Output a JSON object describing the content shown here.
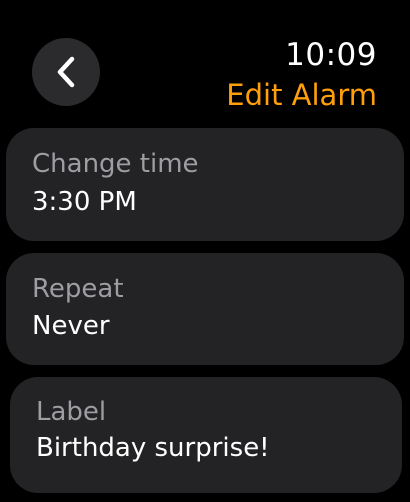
{
  "header": {
    "back_icon": "chevron-left-icon",
    "time": "10:09",
    "title": "Edit Alarm"
  },
  "colors": {
    "accent": "#ff9f0a",
    "background": "#000000",
    "row_background": "#232325",
    "label_text": "#9d9da2",
    "value_text": "#ffffff"
  },
  "rows": [
    {
      "label": "Change time",
      "value": "3:30 PM"
    },
    {
      "label": "Repeat",
      "value": "Never"
    },
    {
      "label": "Label",
      "value": "Birthday surprise!"
    }
  ]
}
